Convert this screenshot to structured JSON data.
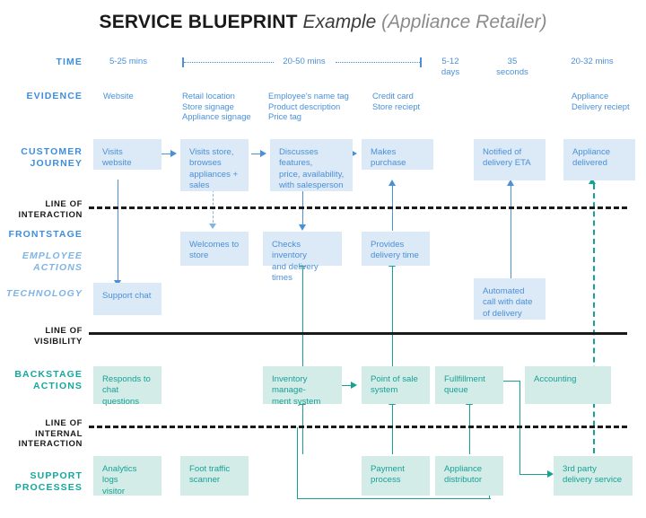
{
  "title": {
    "bold": "SERVICE BLUEPRINT",
    "italic": "Example",
    "grey": "(Appliance Retailer)"
  },
  "colors": {
    "blue_accent": "#4a90d9",
    "blue_light_fill": "#dce9f6",
    "teal_accent": "#17a195",
    "teal_light_fill": "#d4ece8",
    "line_dark": "#1a1a1a",
    "label_light_blue": "#7fb4e6"
  },
  "row_labels": {
    "time": "TIME",
    "evidence": "EVIDENCE",
    "customer_journey": "CUSTOMER\nJOURNEY",
    "line_of_interaction": "LINE OF\nINTERACTION",
    "frontstage": "FRONTSTAGE",
    "employee_actions": "EMPLOYEE\nACTIONS",
    "technology": "TECHNOLOGY",
    "line_of_visibility": "LINE OF\nVISIBILITY",
    "backstage_actions": "BACKSTAGE\nACTIONS",
    "line_of_internal_interaction": "LINE OF\nINTERNAL\nINTERACTION",
    "support_processes": "SUPPORT\nPROCESSES"
  },
  "time_row": {
    "cells": [
      {
        "text": "5-25 mins"
      },
      {
        "text": "20-50 mins"
      },
      {
        "text": "5-12\ndays"
      },
      {
        "text": "35\nseconds"
      },
      {
        "text": "20-32 mins"
      }
    ]
  },
  "evidence_row": {
    "cells": [
      {
        "text": "Website"
      },
      {
        "text": "Retail location\nStore signage\nAppliance signage"
      },
      {
        "text": "Employee's name tag\nProduct description\nPrice tag"
      },
      {
        "text": "Credit card\nStore reciept"
      },
      {
        "text": "Appliance\nDelivery reciept"
      }
    ]
  },
  "customer_journey": {
    "boxes": [
      {
        "text": "Visits website"
      },
      {
        "text": "Visits store,\nbrowses\nappliances +\nsales"
      },
      {
        "text": "Discusses features,\nprice, availability,\nwith salesperson"
      },
      {
        "text": "Makes purchase"
      },
      {
        "text": "Notified of\ndelivery ETA"
      },
      {
        "text": "Appliance\ndelivered"
      }
    ]
  },
  "employee_actions": {
    "boxes": [
      {
        "text": "Welcomes to\nstore"
      },
      {
        "text": "Checks inventory\nand delivery times"
      },
      {
        "text": "Provides\ndelivery time"
      }
    ]
  },
  "technology": {
    "boxes": [
      {
        "text": "Support chat"
      },
      {
        "text": "Automated\ncall with date\nof delivery"
      }
    ]
  },
  "backstage_actions": {
    "boxes": [
      {
        "text": "Responds to\nchat questions"
      },
      {
        "text": "Inventory manage-\nment system"
      },
      {
        "text": "Point of sale\nsystem"
      },
      {
        "text": "Fullfillment\nqueue"
      },
      {
        "text": "Accounting"
      }
    ]
  },
  "support_processes": {
    "boxes": [
      {
        "text": "Analytics logs\nvisitor"
      },
      {
        "text": "Foot traffic\nscanner"
      },
      {
        "text": "Payment\nprocess"
      },
      {
        "text": "Appliance\ndistributor"
      },
      {
        "text": "3rd party\ndelivery service"
      }
    ]
  }
}
